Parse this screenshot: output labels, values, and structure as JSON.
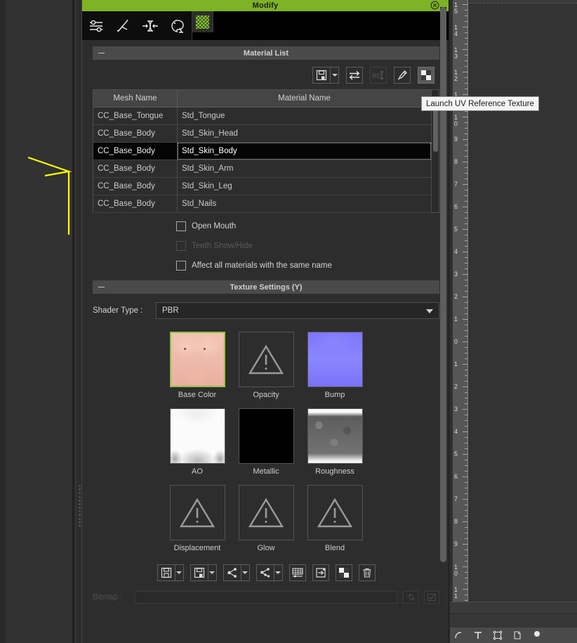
{
  "window": {
    "title": "Modify",
    "title_color": "#7db324",
    "close_icon": "close-circle-icon"
  },
  "toolstrip": {
    "buttons": [
      {
        "name": "adjust-sliders-icon",
        "label": "Adjust"
      },
      {
        "name": "pose-edit-icon",
        "label": "Pose"
      },
      {
        "name": "mesh-constrain-icon",
        "label": "Mesh"
      },
      {
        "name": "palette-icon",
        "label": "Material Palette"
      }
    ],
    "active_button": {
      "name": "checker-texture-icon",
      "label": "Texture Settings"
    }
  },
  "material_list": {
    "section_title": "Material List",
    "collapse_glyph": "minus-icon",
    "toolbar": [
      {
        "name": "save-material-button",
        "icon": "floppy-save-icon",
        "has_dropdown": true,
        "enabled": true
      },
      {
        "name": "swap-material-button",
        "icon": "swap-arrows-icon",
        "has_dropdown": false,
        "enabled": true
      },
      {
        "name": "rename-material-button",
        "icon": "rename-text-icon",
        "label": "RE",
        "has_dropdown": false,
        "enabled": false
      },
      {
        "name": "pick-material-button",
        "icon": "eyedropper-icon",
        "has_dropdown": false,
        "enabled": true
      },
      {
        "name": "launch-uv-reference-texture-button",
        "icon": "checker-square-icon",
        "has_dropdown": false,
        "enabled": true,
        "selected": true
      }
    ],
    "columns": [
      "Mesh Name",
      "Material Name"
    ],
    "rows": [
      {
        "mesh": "CC_Base_Tongue",
        "material": "Std_Tongue",
        "selected": false
      },
      {
        "mesh": "CC_Base_Body",
        "material": "Std_Skin_Head",
        "selected": false
      },
      {
        "mesh": "CC_Base_Body",
        "material": "Std_Skin_Body",
        "selected": true
      },
      {
        "mesh": "CC_Base_Body",
        "material": "Std_Skin_Arm",
        "selected": false
      },
      {
        "mesh": "CC_Base_Body",
        "material": "Std_Skin_Leg",
        "selected": false
      },
      {
        "mesh": "CC_Base_Body",
        "material": "Std_Nails",
        "selected": false
      }
    ]
  },
  "tooltip": {
    "text": "Launch UV Reference Texture"
  },
  "options": [
    {
      "label": "Open Mouth",
      "checked": false,
      "enabled": true,
      "name": "open-mouth-checkbox"
    },
    {
      "label": "Teeth Show/Hide",
      "checked": false,
      "enabled": false,
      "name": "teeth-show-hide-checkbox"
    },
    {
      "label": "Affect all materials with the same name",
      "checked": false,
      "enabled": true,
      "name": "affect-all-materials-checkbox"
    }
  ],
  "texture_settings": {
    "section_title": "Texture Settings  (Y)",
    "shader_label": "Shader Type :",
    "shader_value": "PBR",
    "shader_options": [
      "PBR"
    ],
    "highlight_color": "#8cc63f",
    "channels": [
      {
        "label": "Base Color",
        "thumb": "skin",
        "highlighted": true
      },
      {
        "label": "Opacity",
        "thumb": "missing",
        "highlighted": false
      },
      {
        "label": "Bump",
        "thumb": "bump",
        "highlighted": false
      },
      {
        "label": "AO",
        "thumb": "ao",
        "highlighted": false
      },
      {
        "label": "Metallic",
        "thumb": "metallic",
        "highlighted": false
      },
      {
        "label": "Roughness",
        "thumb": "roughness",
        "highlighted": false
      },
      {
        "label": "Displacement",
        "thumb": "missing",
        "highlighted": false
      },
      {
        "label": "Glow",
        "thumb": "missing",
        "highlighted": false
      },
      {
        "label": "Blend",
        "thumb": "missing",
        "highlighted": false
      }
    ]
  },
  "bottom_toolbar": [
    {
      "name": "save-texture-button",
      "icon": "floppy-icon",
      "has_dropdown": true
    },
    {
      "name": "save-texture-as-button",
      "icon": "floppy-copy-icon",
      "has_dropdown": true
    },
    {
      "name": "load-texture-button",
      "icon": "node-link-icon",
      "has_dropdown": true
    },
    {
      "name": "share-texture-button",
      "icon": "share-nodes-icon",
      "has_dropdown": true
    },
    {
      "name": "tile-texture-button",
      "icon": "grid-slider-icon",
      "has_dropdown": false
    },
    {
      "name": "import-texture-button",
      "icon": "arrow-into-box-icon",
      "has_dropdown": false
    },
    {
      "name": "checker-preview-button",
      "icon": "checker-square-icon",
      "has_dropdown": false
    },
    {
      "name": "delete-texture-button",
      "icon": "trash-icon",
      "has_dropdown": false
    }
  ],
  "bitmap": {
    "label": "Bitmap :",
    "value": "",
    "placeholder": "",
    "browse_icon": "browse-folder-icon",
    "edit_icon": "edit-check-icon"
  },
  "ruler": {
    "orientation": "vertical",
    "labels_top_to_bottom": [
      "15",
      "14",
      "13",
      "12",
      "11",
      "10",
      "9",
      "8",
      "7",
      "6",
      "5",
      "4",
      "3",
      "2",
      "1",
      "0",
      "1",
      "2",
      "3",
      "4",
      "5",
      "6",
      "7",
      "8",
      "9",
      "10",
      "11"
    ]
  },
  "right_tools": [
    {
      "name": "move-tool-icon"
    },
    {
      "name": "text-tool-icon"
    },
    {
      "name": "transform-tool-icon"
    },
    {
      "name": "page-tool-icon"
    },
    {
      "name": "dot-tool-icon"
    }
  ]
}
